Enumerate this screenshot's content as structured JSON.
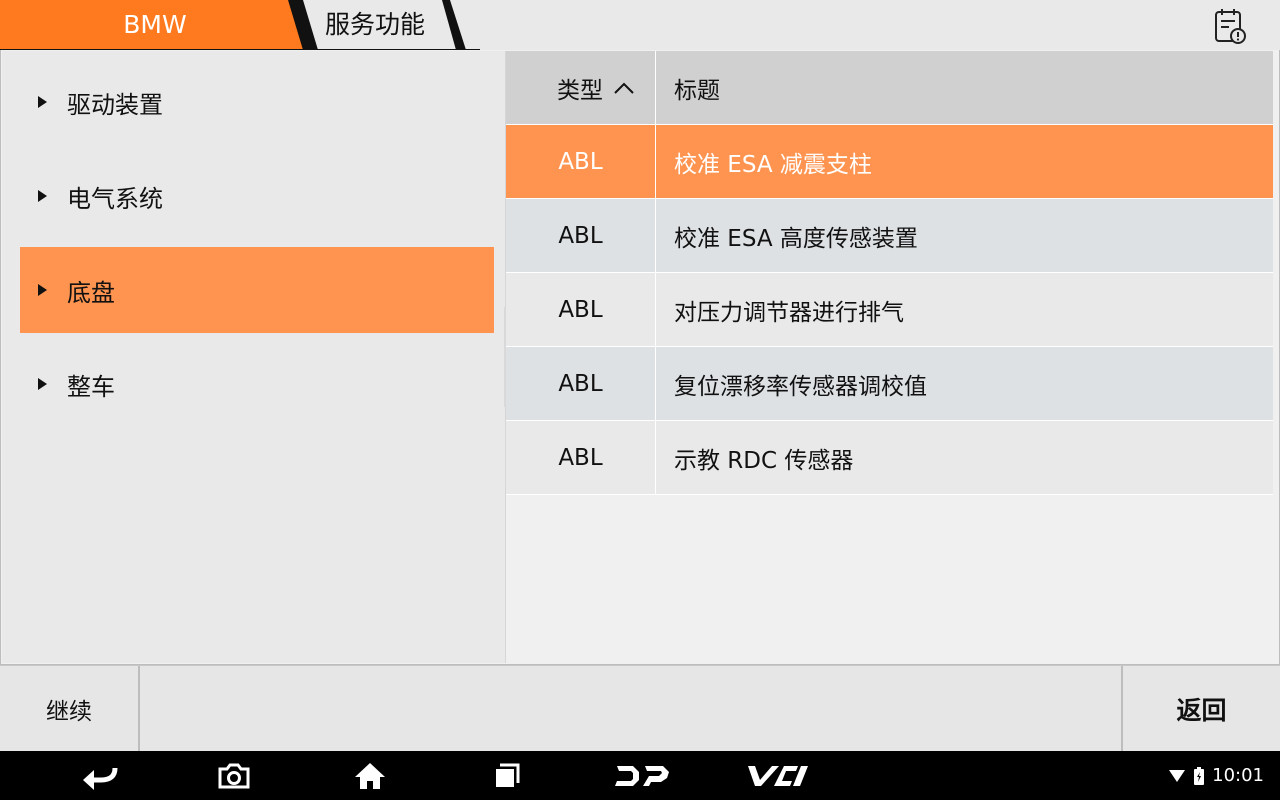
{
  "breadcrumb": {
    "brand": "BMW",
    "section": "服务功能"
  },
  "categories": [
    {
      "label": "驱动装置"
    },
    {
      "label": "电气系统"
    },
    {
      "label": "底盘"
    },
    {
      "label": "整车"
    }
  ],
  "selected_category_index": 2,
  "table": {
    "headers": {
      "type": "类型",
      "title": "标题"
    },
    "rows": [
      {
        "type": "ABL",
        "title": "校准 ESA 减震支柱"
      },
      {
        "type": "ABL",
        "title": "校准 ESA 高度传感装置"
      },
      {
        "type": "ABL",
        "title": "对压力调节器进行排气"
      },
      {
        "type": "ABL",
        "title": "复位漂移率传感器调校值"
      },
      {
        "type": "ABL",
        "title": "示教 RDC 传感器"
      }
    ],
    "selected_row_index": 0
  },
  "actions": {
    "continue": "继续",
    "back": "返回"
  },
  "status": {
    "time": "10:01"
  },
  "colors": {
    "accent": "#ff9450",
    "brand_tab": "#ff7a1e"
  },
  "icons": {
    "report": "clipboard-alert-icon",
    "nav": [
      "back-icon",
      "camera-icon",
      "home-icon",
      "recent-apps-icon",
      "dp-logo-icon",
      "vci-logo-icon"
    ],
    "status": [
      "wifi-icon",
      "battery-icon"
    ]
  }
}
